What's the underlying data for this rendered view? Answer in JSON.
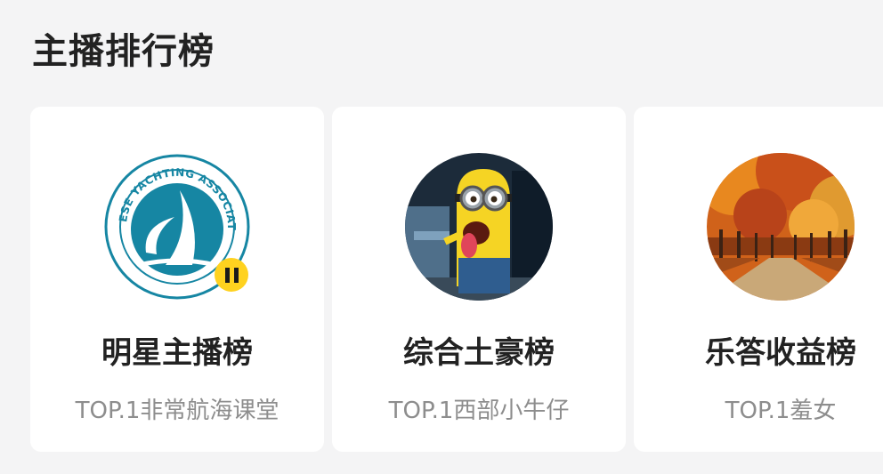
{
  "page": {
    "title": "主播排行榜"
  },
  "cards": [
    {
      "title": "明星主播榜",
      "subtitle": "TOP.1非常航海课堂",
      "avatar_logo_text": "CHINESE YACHTING ASSOCIATION"
    },
    {
      "title": "综合土豪榜",
      "subtitle": "TOP.1西部小牛仔"
    },
    {
      "title": "乐答收益榜",
      "subtitle": "TOP.1羞女"
    }
  ],
  "colors": {
    "background": "#f4f4f5",
    "card": "#ffffff",
    "title_text": "#222222",
    "subtitle_text": "#8d8d8d",
    "badge": "#ffd21f",
    "logo_teal": "#1686a3"
  }
}
